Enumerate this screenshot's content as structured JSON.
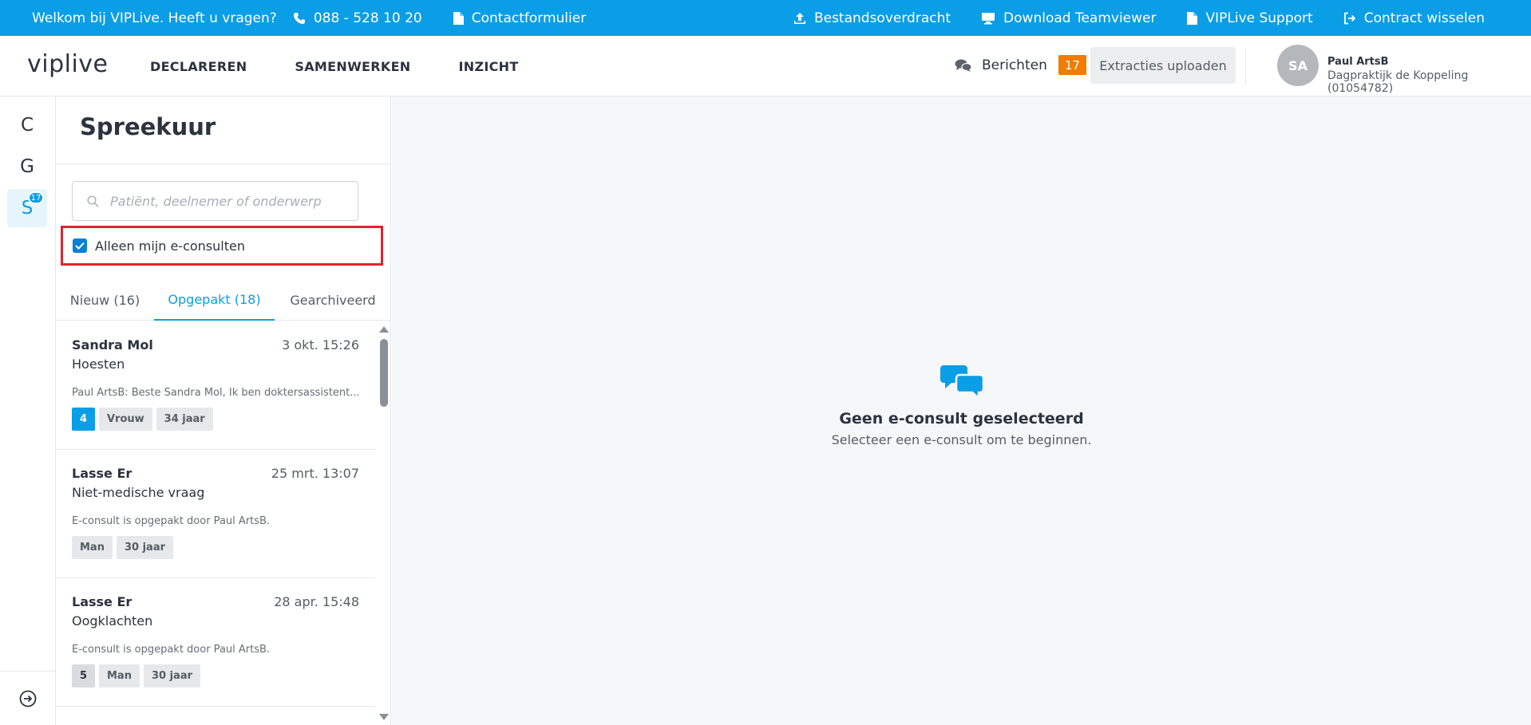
{
  "topbar": {
    "welcome": "Welkom bij VIPLive. Heeft u vragen?",
    "phone": "088 - 528 10 20",
    "contact": "Contactformulier",
    "transfer": "Bestandsoverdracht",
    "teamviewer": "Download Teamviewer",
    "support": "VIPLive Support",
    "contract": "Contract wisselen"
  },
  "header": {
    "logo": "viplive",
    "nav": [
      "DECLAREREN",
      "SAMENWERKEN",
      "INZICHT"
    ],
    "messages_label": "Berichten",
    "messages_count": "17",
    "upload_button": "Extracties uploaden",
    "avatar_initials": "SA",
    "user_name": "Paul ArtsB",
    "user_org": "Dagpraktijk de Koppeling (01054782)"
  },
  "rail": {
    "items": [
      "C",
      "G",
      "S"
    ],
    "badge": "17"
  },
  "panel": {
    "title": "Spreekuur",
    "search_placeholder": "Patiënt, deelnemer of onderwerp",
    "filter_label": "Alleen mijn e-consulten",
    "tabs": [
      "Nieuw (16)",
      "Opgepakt (18)",
      "Gearchiveerd"
    ],
    "cards": [
      {
        "name": "Sandra Mol",
        "date": "3 okt. 15:26",
        "subject": "Hoesten",
        "preview": "Paul ArtsB: Beste Sandra Mol, Ik ben doktersassistent...",
        "number": "4",
        "tags": [
          "Vrouw",
          "34 jaar"
        ]
      },
      {
        "name": "Lasse Er",
        "date": "25 mrt. 13:07",
        "subject": "Niet-medische vraag",
        "preview": "E-consult is opgepakt door Paul ArtsB.",
        "number": "",
        "tags": [
          "Man",
          "30 jaar"
        ]
      },
      {
        "name": "Lasse Er",
        "date": "28 apr. 15:48",
        "subject": "Oogklachten",
        "preview": "E-consult is opgepakt door Paul ArtsB.",
        "number": "5",
        "tags": [
          "Man",
          "30 jaar"
        ]
      }
    ]
  },
  "main": {
    "empty_title": "Geen e-consult geselecteerd",
    "empty_subtitle": "Selecteer een e-consult om te beginnen."
  },
  "colors": {
    "brand_blue": "#0a9ee6",
    "badge_orange": "#f07c00",
    "highlight_red": "#e0242f"
  }
}
